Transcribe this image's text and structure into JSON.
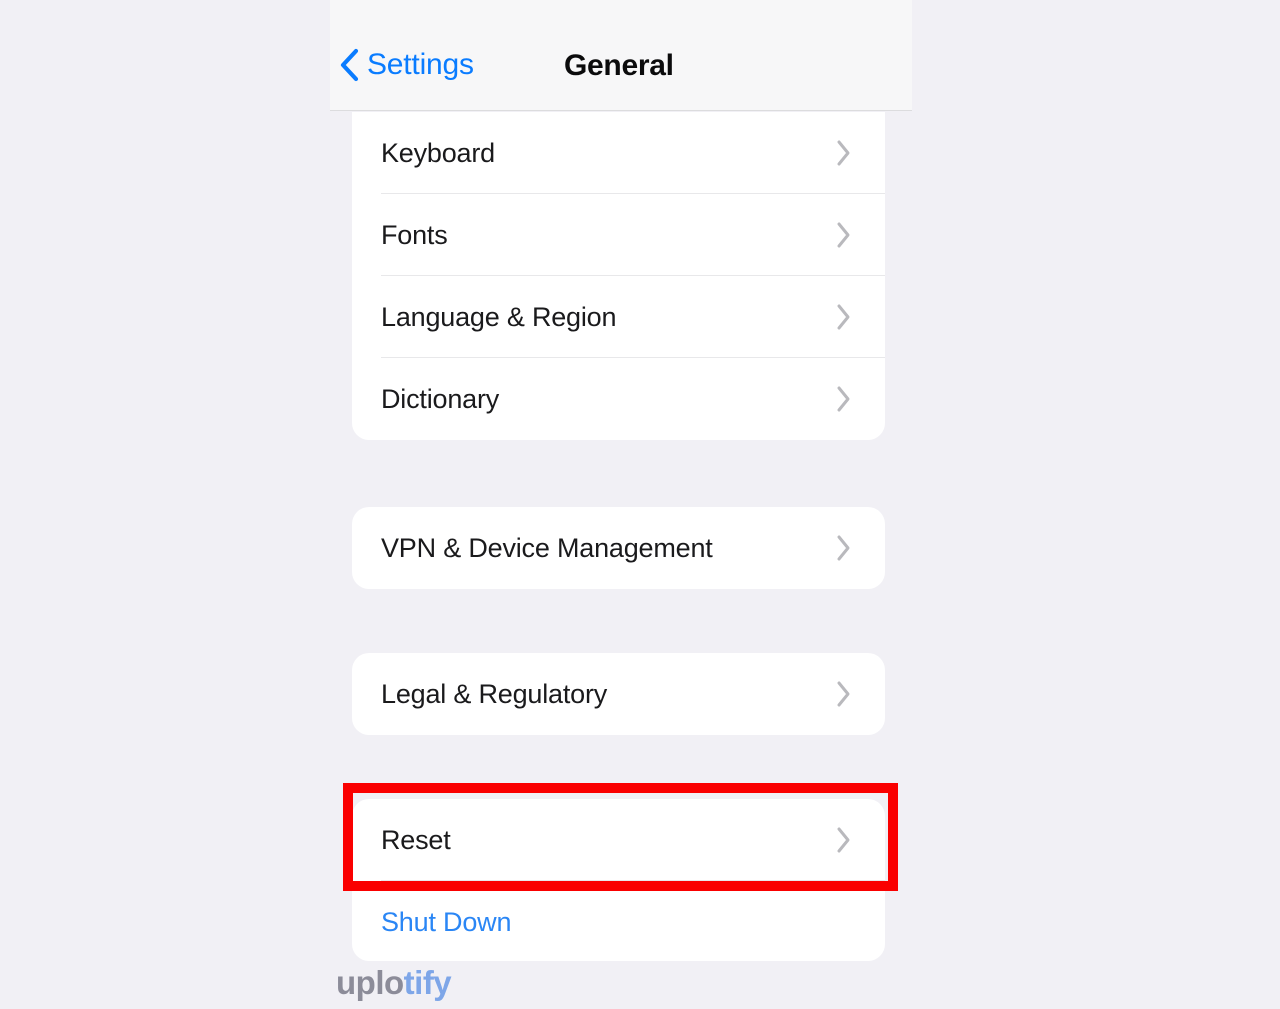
{
  "app": {
    "platform": "ios-settings"
  },
  "nav": {
    "back_label": "Settings",
    "back_icon": "chevron-left-icon",
    "title": "General",
    "accent_color": "#0a7cff"
  },
  "groups": [
    {
      "id": "settings-group",
      "clipped_top": true,
      "rows": [
        {
          "label": "Keyboard",
          "accessory": "chevron-right-icon",
          "style": "default"
        },
        {
          "label": "Fonts",
          "accessory": "chevron-right-icon",
          "style": "default"
        },
        {
          "label": "Language & Region",
          "accessory": "chevron-right-icon",
          "style": "default"
        },
        {
          "label": "Dictionary",
          "accessory": "chevron-right-icon",
          "style": "default"
        }
      ]
    },
    {
      "id": "vpn-group",
      "clipped_top": false,
      "rows": [
        {
          "label": "VPN & Device Management",
          "accessory": "chevron-right-icon",
          "style": "default"
        }
      ]
    },
    {
      "id": "legal-group",
      "clipped_top": false,
      "rows": [
        {
          "label": "Legal & Regulatory",
          "accessory": "chevron-right-icon",
          "style": "default"
        }
      ]
    },
    {
      "id": "reset-group",
      "clipped_top": false,
      "rows": [
        {
          "label": "Reset",
          "accessory": "chevron-right-icon",
          "style": "default"
        },
        {
          "label": "Shut Down",
          "accessory": "none",
          "style": "blue"
        }
      ]
    }
  ],
  "highlight": {
    "target": "Reset",
    "color": "#fa0000",
    "thickness_px": 10
  },
  "watermark": {
    "part_gray": "uplo",
    "part_blue": "tify",
    "gray_color": "#8c8c99",
    "blue_color": "#7ea6e8"
  }
}
